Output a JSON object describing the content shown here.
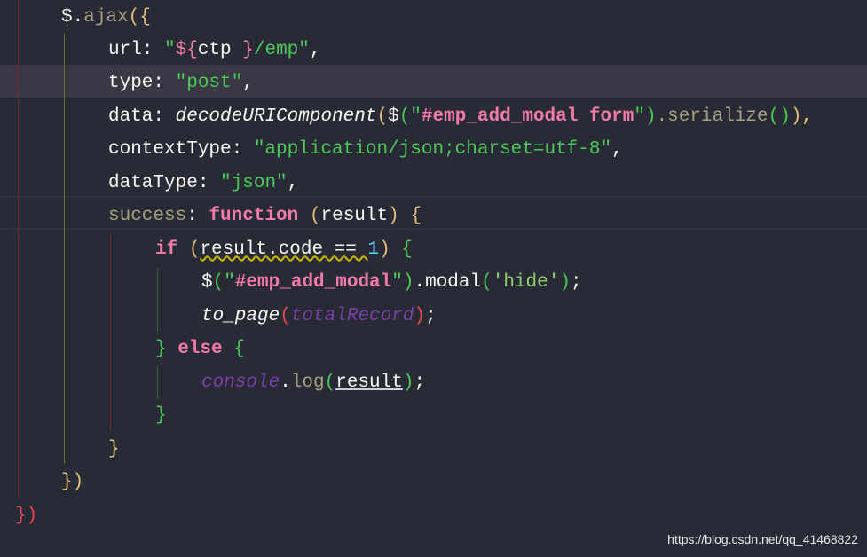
{
  "code": {
    "l1": {
      "a": "$.",
      "b": "ajax",
      "c": "({"
    },
    "l2": {
      "a": "url: ",
      "b": "\"",
      "c": "${",
      "d": "ctp ",
      "e": "}",
      "f": "/emp",
      "g": "\"",
      "h": ","
    },
    "l3": {
      "a": "type: ",
      "b": "\"post\"",
      "c": ","
    },
    "l4": {
      "a": "data: ",
      "b": "decodeURIComponent",
      "c": "(",
      "d": "$",
      "e": "(",
      "f": "\"",
      "g": "#emp_add_modal form",
      "h": "\"",
      "i": ")",
      "j": ".serialize",
      "k": "()",
      "l": "),"
    },
    "l5": {
      "a": "contextType: ",
      "b": "\"application/json;charset=utf-8\"",
      "c": ","
    },
    "l6": {
      "a": "dataType: ",
      "b": "\"json\"",
      "c": ","
    },
    "l7": {
      "a": "success",
      "b": ": ",
      "c": "function",
      "d": " ",
      "e": "(",
      "f": "result",
      "g": ")",
      "h": " {"
    },
    "l8": {
      "a": "if",
      "b": " ",
      "c": "(",
      "d": "result.code == ",
      "e": "1",
      "f": ")",
      "g": " {"
    },
    "l9": {
      "a": "$",
      "b": "(",
      "c": "\"",
      "d": "#emp_add_modal",
      "e": "\"",
      "f": ")",
      "g": ".modal",
      "h": "(",
      "i": "'hide'",
      "j": ")",
      "k": ";"
    },
    "l10": {
      "a": "to_page",
      "b": "(",
      "c": "totalRecord",
      "d": ")",
      "e": ";"
    },
    "l11": {
      "a": "}",
      "b": " else ",
      "c": "{"
    },
    "l12": {
      "a": "console",
      "b": ".",
      "c": "log",
      "d": "(",
      "e": "result",
      "f": ")",
      "g": ";"
    },
    "l13": {
      "a": "}"
    },
    "l14": {
      "a": "}"
    },
    "l15": {
      "a": "})"
    },
    "l16": {
      "a": "})"
    }
  },
  "watermark": "https://blog.csdn.net/qq_41468822",
  "colors": {
    "background": "#282a36",
    "current_line": "#3b3845",
    "keyword": "#f07aa8",
    "string": "#4cc957",
    "number": "#5fd7ff",
    "identifier_italic": "#7b3fa8"
  }
}
